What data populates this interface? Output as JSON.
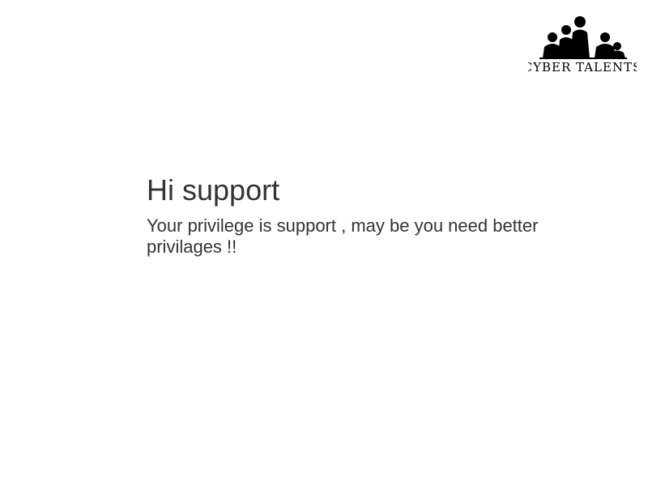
{
  "header": {
    "logo_text": "CYBER TALENTS",
    "logo_icon": "people-silhouette-icon"
  },
  "main": {
    "title": "Hi support",
    "message": "Your privilege is support , may be you need better privilages !!"
  }
}
